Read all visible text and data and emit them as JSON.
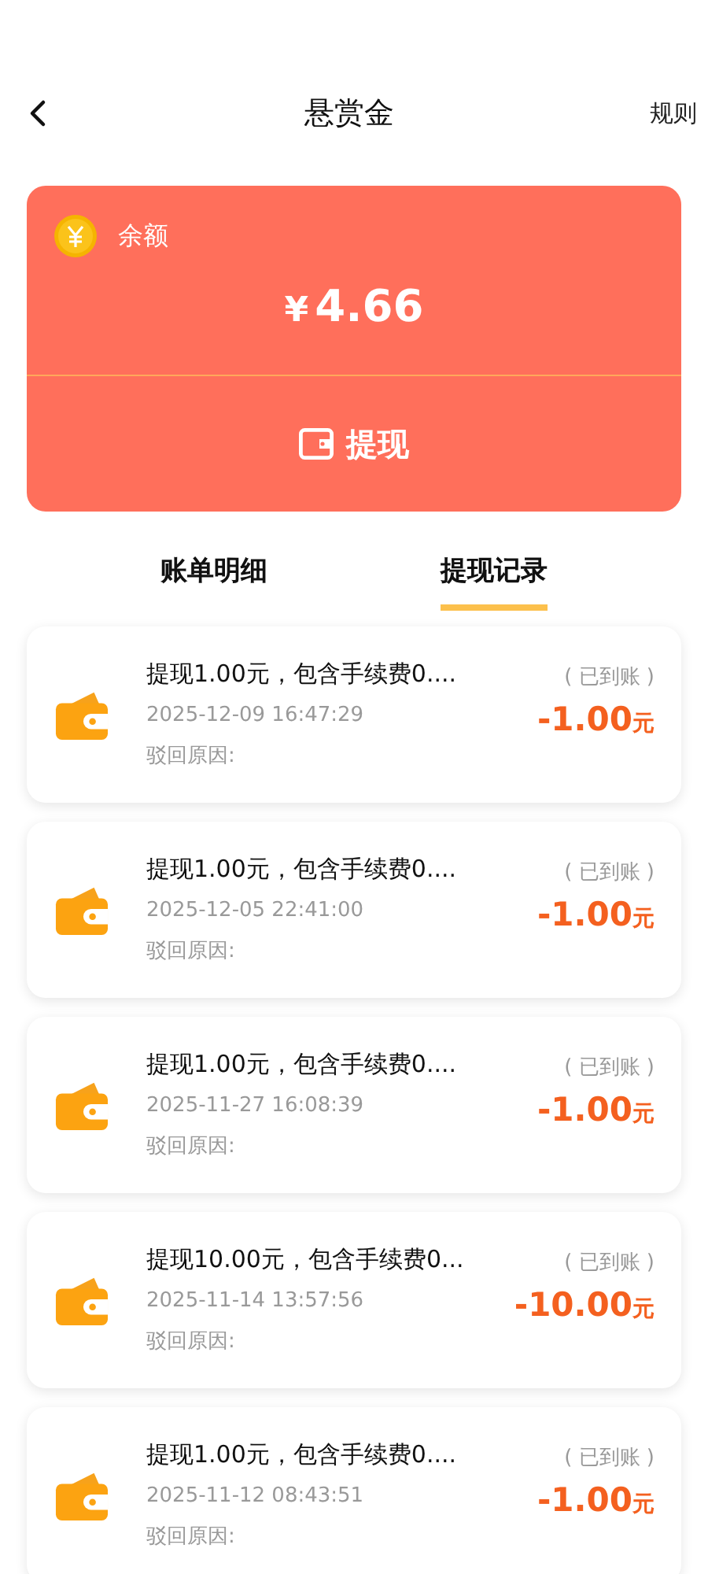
{
  "header": {
    "title": "悬赏金",
    "action": "规则"
  },
  "balance": {
    "label": "余额",
    "currency": "¥",
    "amount": "4.66",
    "button": "提现"
  },
  "tabs": [
    {
      "label": "账单明细",
      "selected": false
    },
    {
      "label": "提现记录",
      "selected": true
    }
  ],
  "records": [
    {
      "title": "提现1.00元，包含手续费0....",
      "time": "2025-12-09 16:47:29",
      "reason": "驳回原因:",
      "status": "( 已到账 )",
      "amount": "-1.00",
      "unit": "元"
    },
    {
      "title": "提现1.00元，包含手续费0....",
      "time": "2025-12-05 22:41:00",
      "reason": "驳回原因:",
      "status": "( 已到账 )",
      "amount": "-1.00",
      "unit": "元"
    },
    {
      "title": "提现1.00元，包含手续费0....",
      "time": "2025-11-27 16:08:39",
      "reason": "驳回原因:",
      "status": "( 已到账 )",
      "amount": "-1.00",
      "unit": "元"
    },
    {
      "title": "提现10.00元，包含手续费0...",
      "time": "2025-11-14 13:57:56",
      "reason": "驳回原因:",
      "status": "( 已到账 )",
      "amount": "-10.00",
      "unit": "元"
    },
    {
      "title": "提现1.00元，包含手续费0....",
      "time": "2025-11-12 08:43:51",
      "reason": "驳回原因:",
      "status": "( 已到账 )",
      "amount": "-1.00",
      "unit": "元"
    }
  ]
}
